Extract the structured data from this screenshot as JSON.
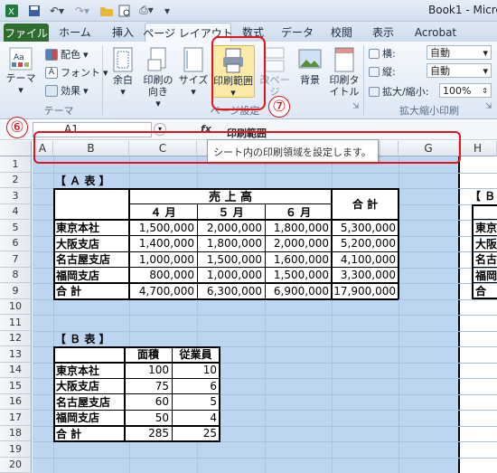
{
  "window": {
    "title": "Book1 - Micros"
  },
  "tabs": [
    "ファイル",
    "ホーム",
    "挿入",
    "ページ レイアウト",
    "数式",
    "データ",
    "校閲",
    "表示",
    "Acrobat"
  ],
  "ribbon": {
    "theme_label": "テーマ",
    "colors_label": "配色",
    "fonts_label": "フォント",
    "effects_label": "効果",
    "theme_group": "テーマ",
    "margins_label": "余白",
    "orientation_label": "印刷の向き",
    "size_label": "サイズ",
    "print_area_label": "印刷範囲",
    "breaks_label": "改ページ",
    "background_label": "背景",
    "print_titles_label": "印刷タイトル",
    "page_setup_group": "ページ設定",
    "width_label": "横:",
    "width_value": "自動",
    "height_label": "縦:",
    "height_value": "自動",
    "scale_label": "拡大/縮小:",
    "scale_value": "100%",
    "scale_group": "拡大縮小印刷"
  },
  "formula_bar": {
    "name_box": "A1",
    "fx": "fx"
  },
  "tooltip": {
    "title": "印刷範囲",
    "description": "シート内の印刷領域を設定します。"
  },
  "annotations": {
    "step6": "⑥",
    "step7": "⑦"
  },
  "columns": [
    "A",
    "B",
    "C",
    "D",
    "E",
    "F",
    "G",
    "H"
  ],
  "rows": [
    "1",
    "2",
    "3",
    "4",
    "5",
    "6",
    "7",
    "8",
    "9",
    "10",
    "11",
    "12",
    "13",
    "14",
    "15",
    "16",
    "17",
    "18",
    "19",
    "20"
  ],
  "table_a": {
    "title": "【 Ａ 表 】",
    "header": "売 上 高",
    "months": [
      "４ 月",
      "５ 月",
      "６ 月"
    ],
    "total_header": "合 計",
    "rows": [
      {
        "name": "東京本社",
        "values": [
          "1,500,000",
          "2,000,000",
          "1,800,000",
          "5,300,000"
        ]
      },
      {
        "name": "大阪支店",
        "values": [
          "1,400,000",
          "1,800,000",
          "2,000,000",
          "5,200,000"
        ]
      },
      {
        "name": "名古屋支店",
        "values": [
          "1,000,000",
          "1,500,000",
          "1,600,000",
          "4,100,000"
        ]
      },
      {
        "name": "福岡支店",
        "values": [
          "800,000",
          "1,000,000",
          "1,500,000",
          "3,300,000"
        ]
      },
      {
        "name": "合 計",
        "values": [
          "4,700,000",
          "6,300,000",
          "6,900,000",
          "17,900,000"
        ]
      }
    ]
  },
  "table_b": {
    "title": "【 Ｂ 表 】",
    "headers": [
      "面積",
      "従業員"
    ],
    "rows": [
      {
        "name": "東京本社",
        "values": [
          "100",
          "10"
        ]
      },
      {
        "name": "大阪支店",
        "values": [
          "75",
          "6"
        ]
      },
      {
        "name": "名古屋支店",
        "values": [
          "60",
          "5"
        ]
      },
      {
        "name": "福岡支店",
        "values": [
          "50",
          "4"
        ]
      },
      {
        "name": "合 計",
        "values": [
          "285",
          "25"
        ]
      }
    ]
  },
  "side_table": {
    "title": "【 Ｂ",
    "rows": [
      "東京",
      "大阪",
      "名古",
      "福岡",
      "合"
    ]
  }
}
